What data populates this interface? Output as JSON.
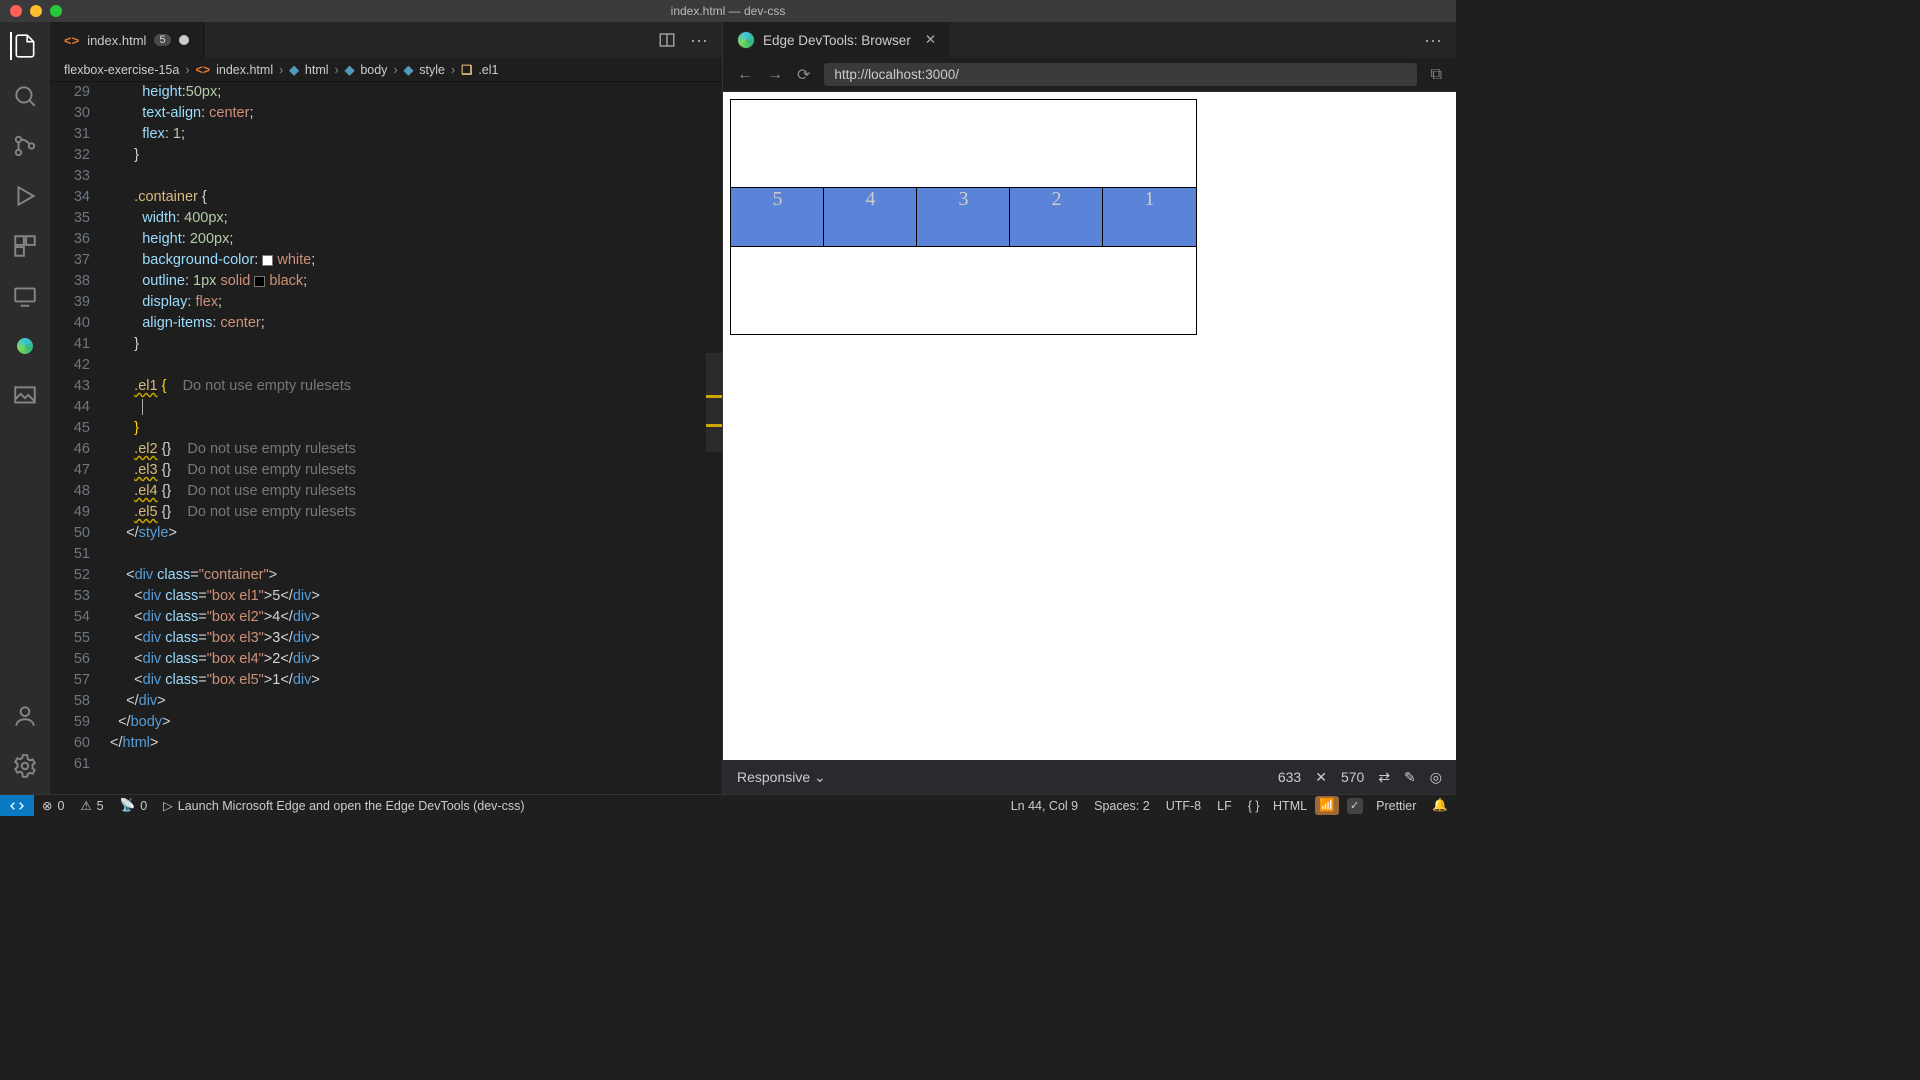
{
  "window_title": "index.html — dev-css",
  "tab": {
    "file_icon": "<>",
    "name": "index.html",
    "warn": "5"
  },
  "tab_actions_split_icon": "split",
  "tab_actions_more": "···",
  "breadcrumb": [
    "flexbox-exercise-15a",
    "index.html",
    "html",
    "body",
    "style",
    ".el1"
  ],
  "gutter_start": 29,
  "code_lines": [
    {
      "n": 29,
      "seg": [
        [
          "",
          "        "
        ],
        [
          "prop",
          "height"
        ],
        [
          "punc",
          ":"
        ],
        [
          "num",
          "50px"
        ],
        [
          "punc",
          ";"
        ]
      ]
    },
    {
      "n": 30,
      "seg": [
        [
          "",
          "        "
        ],
        [
          "prop",
          "text-align"
        ],
        [
          "punc",
          ": "
        ],
        [
          "val",
          "center"
        ],
        [
          "punc",
          ";"
        ]
      ]
    },
    {
      "n": 31,
      "seg": [
        [
          "",
          "        "
        ],
        [
          "prop",
          "flex"
        ],
        [
          "punc",
          ": "
        ],
        [
          "num",
          "1"
        ],
        [
          "punc",
          ";"
        ]
      ]
    },
    {
      "n": 32,
      "seg": [
        [
          "",
          "      "
        ],
        [
          "punc",
          "}"
        ]
      ]
    },
    {
      "n": 33,
      "seg": [
        [
          "",
          ""
        ]
      ]
    },
    {
      "n": 34,
      "seg": [
        [
          "",
          "      "
        ],
        [
          "sel",
          ".container"
        ],
        [
          "",
          " "
        ],
        [
          "punc",
          "{"
        ]
      ]
    },
    {
      "n": 35,
      "seg": [
        [
          "",
          "        "
        ],
        [
          "prop",
          "width"
        ],
        [
          "punc",
          ": "
        ],
        [
          "num",
          "400px"
        ],
        [
          "punc",
          ";"
        ]
      ]
    },
    {
      "n": 36,
      "seg": [
        [
          "",
          "        "
        ],
        [
          "prop",
          "height"
        ],
        [
          "punc",
          ": "
        ],
        [
          "num",
          "200px"
        ],
        [
          "punc",
          ";"
        ]
      ]
    },
    {
      "n": 37,
      "seg": [
        [
          "",
          "        "
        ],
        [
          "prop",
          "background-color"
        ],
        [
          "punc",
          ": "
        ],
        [
          "swatch",
          "#ffffff"
        ],
        [
          "val",
          "white"
        ],
        [
          "punc",
          ";"
        ]
      ]
    },
    {
      "n": 38,
      "seg": [
        [
          "",
          "        "
        ],
        [
          "prop",
          "outline"
        ],
        [
          "punc",
          ": "
        ],
        [
          "num",
          "1px "
        ],
        [
          "val",
          "solid "
        ],
        [
          "swatch",
          "#000000"
        ],
        [
          "val",
          "black"
        ],
        [
          "punc",
          ";"
        ]
      ]
    },
    {
      "n": 39,
      "seg": [
        [
          "",
          "        "
        ],
        [
          "prop",
          "display"
        ],
        [
          "punc",
          ": "
        ],
        [
          "val",
          "flex"
        ],
        [
          "punc",
          ";"
        ]
      ]
    },
    {
      "n": 40,
      "seg": [
        [
          "",
          "        "
        ],
        [
          "prop",
          "align-items"
        ],
        [
          "punc",
          ": "
        ],
        [
          "val",
          "center"
        ],
        [
          "punc",
          ";"
        ]
      ]
    },
    {
      "n": 41,
      "seg": [
        [
          "",
          "      "
        ],
        [
          "punc",
          "}"
        ]
      ]
    },
    {
      "n": 42,
      "seg": [
        [
          "",
          ""
        ]
      ]
    },
    {
      "n": 43,
      "seg": [
        [
          "",
          "      "
        ],
        [
          "selw",
          ".el1"
        ],
        [
          "",
          " "
        ],
        [
          "brace",
          "{"
        ],
        [
          "",
          "    "
        ],
        [
          "hint",
          "Do not use empty rulesets"
        ]
      ]
    },
    {
      "n": 44,
      "seg": [
        [
          "",
          "        "
        ]
      ],
      "cursor": true
    },
    {
      "n": 45,
      "seg": [
        [
          "",
          "      "
        ],
        [
          "brace",
          "}"
        ]
      ]
    },
    {
      "n": 46,
      "seg": [
        [
          "",
          "      "
        ],
        [
          "selw",
          ".el2"
        ],
        [
          "",
          " "
        ],
        [
          "punc",
          "{}"
        ],
        [
          "",
          "    "
        ],
        [
          "hint",
          "Do not use empty rulesets"
        ]
      ]
    },
    {
      "n": 47,
      "seg": [
        [
          "",
          "      "
        ],
        [
          "selw",
          ".el3"
        ],
        [
          "",
          " "
        ],
        [
          "punc",
          "{}"
        ],
        [
          "",
          "    "
        ],
        [
          "hint",
          "Do not use empty rulesets"
        ]
      ]
    },
    {
      "n": 48,
      "seg": [
        [
          "",
          "      "
        ],
        [
          "selw",
          ".el4"
        ],
        [
          "",
          " "
        ],
        [
          "punc",
          "{}"
        ],
        [
          "",
          "    "
        ],
        [
          "hint",
          "Do not use empty rulesets"
        ]
      ]
    },
    {
      "n": 49,
      "seg": [
        [
          "",
          "      "
        ],
        [
          "selw",
          ".el5"
        ],
        [
          "",
          " "
        ],
        [
          "punc",
          "{}"
        ],
        [
          "",
          "    "
        ],
        [
          "hint",
          "Do not use empty rulesets"
        ]
      ]
    },
    {
      "n": 50,
      "seg": [
        [
          "",
          "    "
        ],
        [
          "punc",
          "</"
        ],
        [
          "tag",
          "style"
        ],
        [
          "punc",
          ">"
        ]
      ]
    },
    {
      "n": 51,
      "seg": [
        [
          "",
          ""
        ]
      ]
    },
    {
      "n": 52,
      "seg": [
        [
          "",
          "    "
        ],
        [
          "punc",
          "<"
        ],
        [
          "tag",
          "div "
        ],
        [
          "attr",
          "class"
        ],
        [
          "punc",
          "="
        ],
        [
          "str",
          "\"container\""
        ],
        [
          "punc",
          ">"
        ]
      ]
    },
    {
      "n": 53,
      "seg": [
        [
          "",
          "      "
        ],
        [
          "punc",
          "<"
        ],
        [
          "tag",
          "div "
        ],
        [
          "attr",
          "class"
        ],
        [
          "punc",
          "="
        ],
        [
          "str",
          "\"box el1\""
        ],
        [
          "punc",
          ">"
        ],
        [
          "",
          "5"
        ],
        [
          "punc",
          "</"
        ],
        [
          "tag",
          "div"
        ],
        [
          "punc",
          ">"
        ]
      ]
    },
    {
      "n": 54,
      "seg": [
        [
          "",
          "      "
        ],
        [
          "punc",
          "<"
        ],
        [
          "tag",
          "div "
        ],
        [
          "attr",
          "class"
        ],
        [
          "punc",
          "="
        ],
        [
          "str",
          "\"box el2\""
        ],
        [
          "punc",
          ">"
        ],
        [
          "",
          "4"
        ],
        [
          "punc",
          "</"
        ],
        [
          "tag",
          "div"
        ],
        [
          "punc",
          ">"
        ]
      ]
    },
    {
      "n": 55,
      "seg": [
        [
          "",
          "      "
        ],
        [
          "punc",
          "<"
        ],
        [
          "tag",
          "div "
        ],
        [
          "attr",
          "class"
        ],
        [
          "punc",
          "="
        ],
        [
          "str",
          "\"box el3\""
        ],
        [
          "punc",
          ">"
        ],
        [
          "",
          "3"
        ],
        [
          "punc",
          "</"
        ],
        [
          "tag",
          "div"
        ],
        [
          "punc",
          ">"
        ]
      ]
    },
    {
      "n": 56,
      "seg": [
        [
          "",
          "      "
        ],
        [
          "punc",
          "<"
        ],
        [
          "tag",
          "div "
        ],
        [
          "attr",
          "class"
        ],
        [
          "punc",
          "="
        ],
        [
          "str",
          "\"box el4\""
        ],
        [
          "punc",
          ">"
        ],
        [
          "",
          "2"
        ],
        [
          "punc",
          "</"
        ],
        [
          "tag",
          "div"
        ],
        [
          "punc",
          ">"
        ]
      ]
    },
    {
      "n": 57,
      "seg": [
        [
          "",
          "      "
        ],
        [
          "punc",
          "<"
        ],
        [
          "tag",
          "div "
        ],
        [
          "attr",
          "class"
        ],
        [
          "punc",
          "="
        ],
        [
          "str",
          "\"box el5\""
        ],
        [
          "punc",
          ">"
        ],
        [
          "",
          "1"
        ],
        [
          "punc",
          "</"
        ],
        [
          "tag",
          "div"
        ],
        [
          "punc",
          ">"
        ]
      ]
    },
    {
      "n": 58,
      "seg": [
        [
          "",
          "    "
        ],
        [
          "punc",
          "</"
        ],
        [
          "tag",
          "div"
        ],
        [
          "punc",
          ">"
        ]
      ]
    },
    {
      "n": 59,
      "seg": [
        [
          "",
          "  "
        ],
        [
          "punc",
          "</"
        ],
        [
          "tag",
          "body"
        ],
        [
          "punc",
          ">"
        ]
      ]
    },
    {
      "n": 60,
      "seg": [
        [
          "",
          ""
        ],
        [
          "punc",
          "</"
        ],
        [
          "tag",
          "html"
        ],
        [
          "punc",
          ">"
        ]
      ]
    },
    {
      "n": 61,
      "seg": [
        [
          "",
          ""
        ]
      ]
    }
  ],
  "devtools_tab": "Edge DevTools: Browser",
  "url": "http://localhost:3000/",
  "preview_boxes": [
    "5",
    "4",
    "3",
    "2",
    "1"
  ],
  "responsive_label": "Responsive",
  "viewport_w": "633",
  "viewport_x": "✕",
  "viewport_h": "570",
  "status": {
    "errors": "0",
    "warnings": "5",
    "ports": "0",
    "launch": "Launch Microsoft Edge and open the Edge DevTools (dev-css)",
    "pos": "Ln 44, Col 9",
    "spaces": "Spaces: 2",
    "enc": "UTF-8",
    "eol": "LF",
    "lang": "HTML",
    "prettier": "Prettier"
  }
}
